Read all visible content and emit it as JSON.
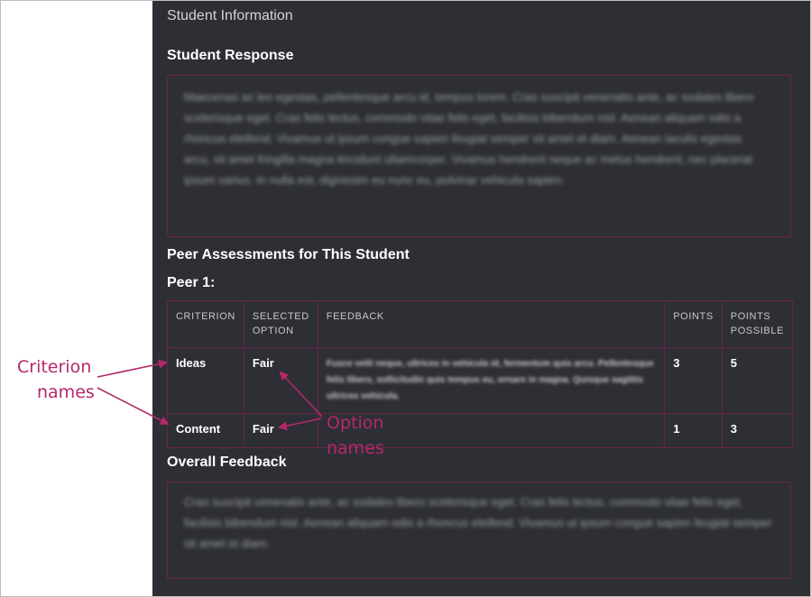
{
  "panel": {
    "title": "Student Information"
  },
  "student_response": {
    "heading": "Student Response",
    "text": "Maecenas ac leo egestas, pellentesque arcu id, tempus lorem. Cras suscipit venenatis ante, ac sodales libero scelerisque eget. Cras felis lectus, commodo vitae felis eget, facilisis bibendum nisl. Aenean aliquam odio a rhoncus eleifend. Vivamus ut ipsum congue sapien feugiat semper sit amet et diam. Aenean iaculis egestas arcu, sit amet fringilla magna tincidunt ullamcorper. Vivamus hendrerit neque ac metus hendrerit, nec placerat ipsum varius. In nulla est, dignissim eu nunc eu, pulvinar vehicula sapien."
  },
  "peer_assessments": {
    "heading": "Peer Assessments for This Student",
    "peer_label": "Peer 1:",
    "columns": {
      "criterion": "CRITERION",
      "selected_option": "SELECTED OPTION",
      "feedback": "FEEDBACK",
      "points": "POINTS",
      "points_possible": "POINTS POSSIBLE"
    },
    "rows": [
      {
        "criterion": "Ideas",
        "option": "Fair",
        "feedback": "Fusce velit neque, ultrices in vehicula id, fermentum quis arcu. Pellentesque felis libero, sollicitudin quis tempus eu, ornare in magna. Quisque sagittis ultrices vehicula.",
        "points": "3",
        "points_possible": "5"
      },
      {
        "criterion": "Content",
        "option": "Fair",
        "feedback": "",
        "points": "1",
        "points_possible": "3"
      }
    ]
  },
  "overall_feedback": {
    "heading": "Overall Feedback",
    "text": "Cras suscipit venenatis ante, ac sodales libero scelerisque eget. Cras felis lectus, commodo vitae felis eget, facilisis bibendum nisl. Aenean aliquam odio a rhoncus eleifend. Vivamus ut ipsum congue sapien feugiat semper sit amet et diam."
  },
  "annotations": {
    "criterion_line1": "Criterion",
    "criterion_line2": "names",
    "option_line1": "Option",
    "option_line2": "names",
    "color": "#b5286a"
  }
}
